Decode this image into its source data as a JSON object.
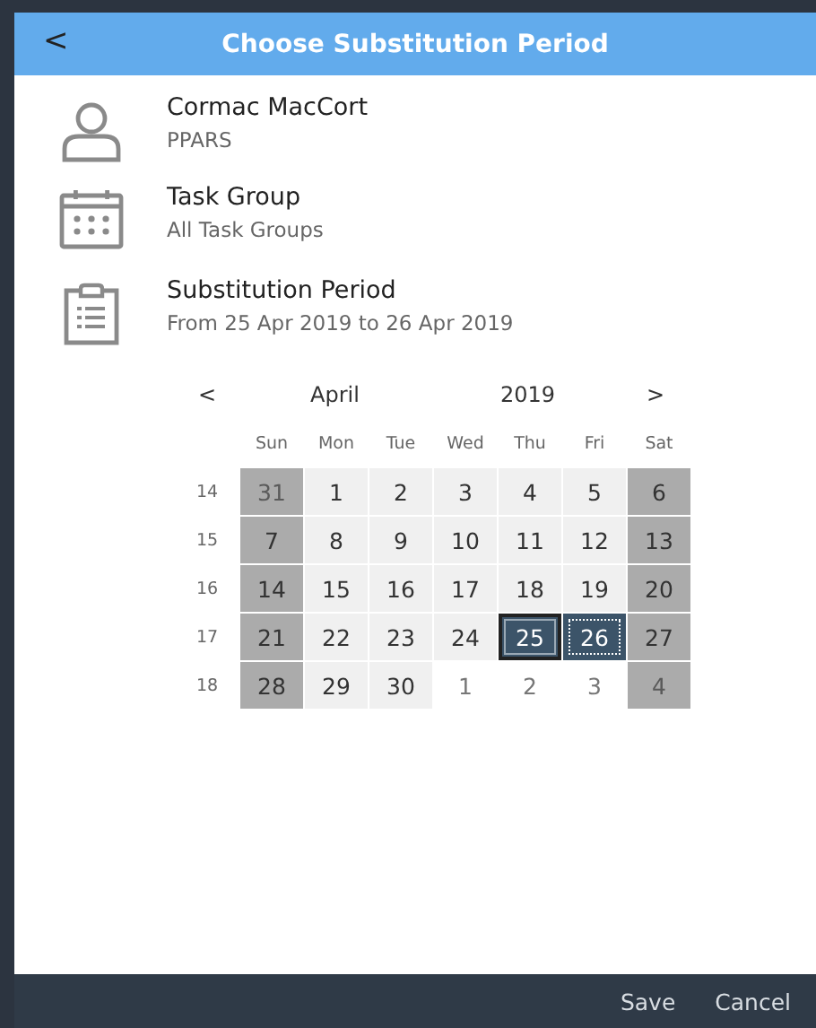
{
  "dialog": {
    "title": "Choose Substitution Period",
    "back": "<"
  },
  "items": [
    {
      "kind": "person",
      "title": "Cormac MacCort",
      "subtitle": "PPARS"
    },
    {
      "kind": "calendar",
      "title": "Task Group",
      "subtitle": "All Task Groups"
    },
    {
      "kind": "clipboard",
      "title": "Substitution Period",
      "subtitle": "From 25 Apr 2019 to 26 Apr 2019"
    }
  ],
  "calendar": {
    "prev": "<",
    "month": "April",
    "year": "2019",
    "next": ">",
    "weekdays": [
      "Sun",
      "Mon",
      "Tue",
      "Wed",
      "Thu",
      "Fri",
      "Sat"
    ],
    "weeks": [
      {
        "number": "14",
        "days": [
          {
            "label": "31",
            "kind": "weekend",
            "other_month": true,
            "selected": false,
            "focused": false
          },
          {
            "label": "1",
            "kind": "weekday",
            "other_month": false,
            "selected": false,
            "focused": false
          },
          {
            "label": "2",
            "kind": "weekday",
            "other_month": false,
            "selected": false,
            "focused": false
          },
          {
            "label": "3",
            "kind": "weekday",
            "other_month": false,
            "selected": false,
            "focused": false
          },
          {
            "label": "4",
            "kind": "weekday",
            "other_month": false,
            "selected": false,
            "focused": false
          },
          {
            "label": "5",
            "kind": "weekday",
            "other_month": false,
            "selected": false,
            "focused": false
          },
          {
            "label": "6",
            "kind": "weekend",
            "other_month": false,
            "selected": false,
            "focused": false
          }
        ]
      },
      {
        "number": "15",
        "days": [
          {
            "label": "7",
            "kind": "weekend",
            "other_month": false,
            "selected": false,
            "focused": false
          },
          {
            "label": "8",
            "kind": "weekday",
            "other_month": false,
            "selected": false,
            "focused": false
          },
          {
            "label": "9",
            "kind": "weekday",
            "other_month": false,
            "selected": false,
            "focused": false
          },
          {
            "label": "10",
            "kind": "weekday",
            "other_month": false,
            "selected": false,
            "focused": false
          },
          {
            "label": "11",
            "kind": "weekday",
            "other_month": false,
            "selected": false,
            "focused": false
          },
          {
            "label": "12",
            "kind": "weekday",
            "other_month": false,
            "selected": false,
            "focused": false
          },
          {
            "label": "13",
            "kind": "weekend",
            "other_month": false,
            "selected": false,
            "focused": false
          }
        ]
      },
      {
        "number": "16",
        "days": [
          {
            "label": "14",
            "kind": "weekend",
            "other_month": false,
            "selected": false,
            "focused": false
          },
          {
            "label": "15",
            "kind": "weekday",
            "other_month": false,
            "selected": false,
            "focused": false
          },
          {
            "label": "16",
            "kind": "weekday",
            "other_month": false,
            "selected": false,
            "focused": false
          },
          {
            "label": "17",
            "kind": "weekday",
            "other_month": false,
            "selected": false,
            "focused": false
          },
          {
            "label": "18",
            "kind": "weekday",
            "other_month": false,
            "selected": false,
            "focused": false
          },
          {
            "label": "19",
            "kind": "weekday",
            "other_month": false,
            "selected": false,
            "focused": false
          },
          {
            "label": "20",
            "kind": "weekend",
            "other_month": false,
            "selected": false,
            "focused": false
          }
        ]
      },
      {
        "number": "17",
        "days": [
          {
            "label": "21",
            "kind": "weekend",
            "other_month": false,
            "selected": false,
            "focused": false
          },
          {
            "label": "22",
            "kind": "weekday",
            "other_month": false,
            "selected": false,
            "focused": false
          },
          {
            "label": "23",
            "kind": "weekday",
            "other_month": false,
            "selected": false,
            "focused": false
          },
          {
            "label": "24",
            "kind": "weekday",
            "other_month": false,
            "selected": false,
            "focused": false
          },
          {
            "label": "25",
            "kind": "weekday",
            "other_month": false,
            "selected": true,
            "focused": false
          },
          {
            "label": "26",
            "kind": "weekday",
            "other_month": false,
            "selected": true,
            "focused": true
          },
          {
            "label": "27",
            "kind": "weekend",
            "other_month": false,
            "selected": false,
            "focused": false
          }
        ]
      },
      {
        "number": "18",
        "days": [
          {
            "label": "28",
            "kind": "weekend",
            "other_month": false,
            "selected": false,
            "focused": false
          },
          {
            "label": "29",
            "kind": "weekday",
            "other_month": false,
            "selected": false,
            "focused": false
          },
          {
            "label": "30",
            "kind": "weekday",
            "other_month": false,
            "selected": false,
            "focused": false
          },
          {
            "label": "1",
            "kind": "weekday",
            "other_month": true,
            "selected": false,
            "focused": false
          },
          {
            "label": "2",
            "kind": "weekday",
            "other_month": true,
            "selected": false,
            "focused": false
          },
          {
            "label": "3",
            "kind": "weekday",
            "other_month": true,
            "selected": false,
            "focused": false
          },
          {
            "label": "4",
            "kind": "weekend",
            "other_month": true,
            "selected": false,
            "focused": false
          }
        ]
      }
    ]
  },
  "footer": {
    "buttons": [
      "Save",
      "Cancel"
    ]
  }
}
